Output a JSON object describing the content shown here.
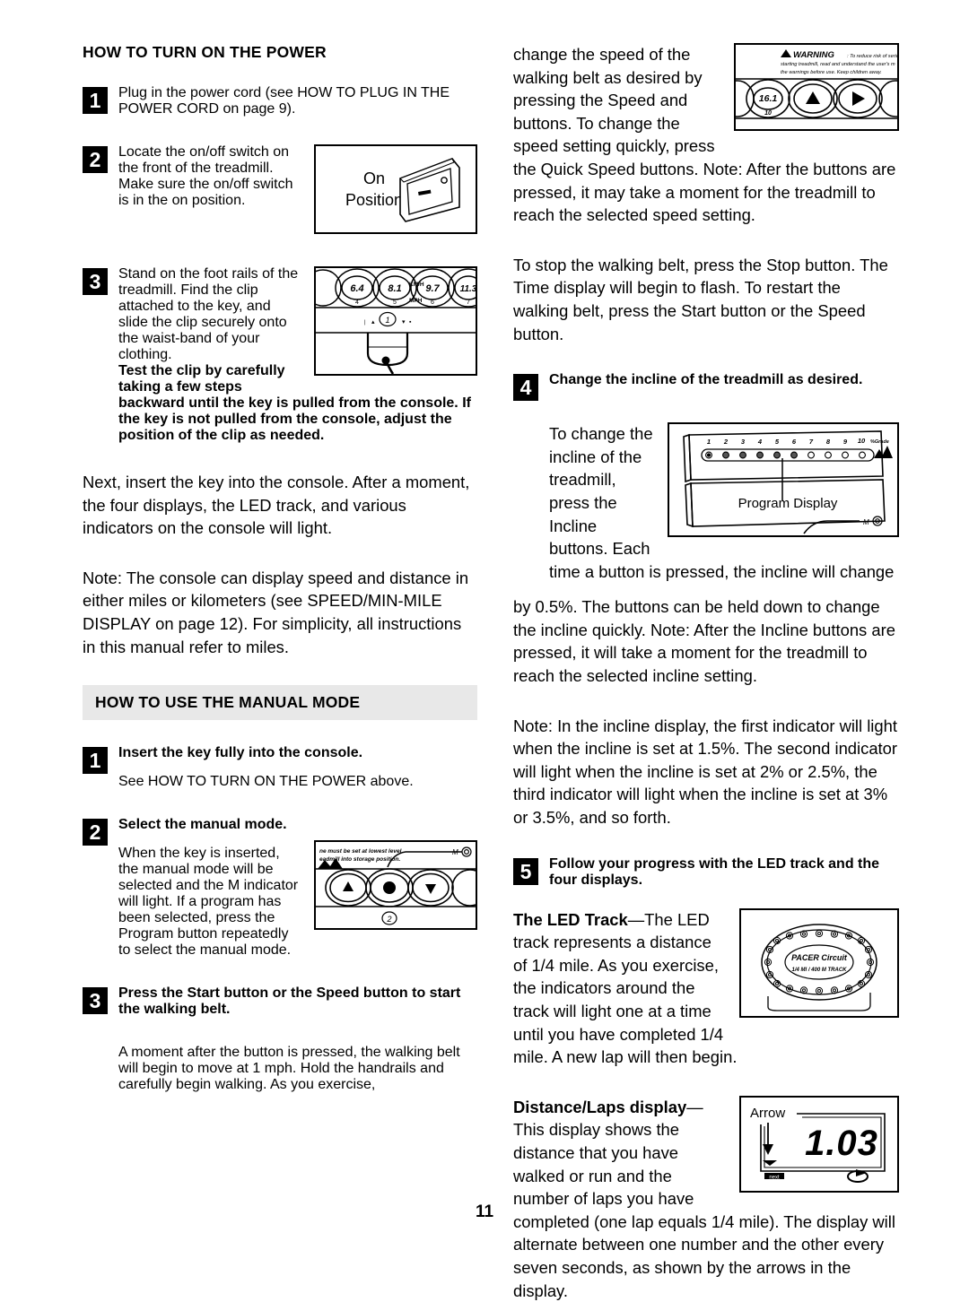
{
  "page": {
    "number": "11"
  },
  "left_column": {
    "section1": {
      "title": "HOW TO TURN ON THE POWER",
      "steps": [
        {
          "num": "1",
          "text": "Plug in the power cord (see HOW TO PLUG IN THE POWER CORD on page 9)."
        },
        {
          "num": "2",
          "text": "Locate the on/off switch on the front of the treadmill. Make sure the on/off switch is in the on position."
        },
        {
          "num": "3",
          "text": "Stand on the foot rails of the treadmill. Find the clip attached to the key, and slide the clip securely onto the waist-band of your clothing. ",
          "bold_text": "Test the clip by carefully taking a few steps backward until the key is pulled from the console. If the key is not pulled from the console, adjust the position of the clip as needed."
        }
      ],
      "paragraph_key": "Next, insert the key into the console. After a moment, the four displays, the LED track, and various indicators on the console will light.",
      "paragraph_note": "Note: The console can display speed and distance in either miles or kilometers (see SPEED/MIN-MILE DISPLAY on page 12). For simplicity, all instructions in this manual refer to miles."
    },
    "section2": {
      "title": "HOW TO USE THE MANUAL MODE",
      "steps": [
        {
          "num": "1",
          "heading": "Insert the key fully into the console.",
          "text": "See HOW TO TURN ON THE POWER above."
        },
        {
          "num": "2",
          "heading": "Select the manual mode.",
          "text": "When the key is inserted, the manual mode will be selected and the M indicator will light. If a program has been selected, press the Program button repeatedly to select the manual mode."
        },
        {
          "num": "3",
          "heading": "Press the Start button or the Speed     button to start the walking belt.",
          "text": "A moment after the button is pressed, the walking belt will begin to move at 1 mph. Hold the handrails and carefully begin walking. As you exercise,"
        }
      ]
    },
    "figures": {
      "switch": {
        "label_line1": "On",
        "label_line2": "Position"
      },
      "quick_speed": {
        "buttons": [
          {
            "kmh": "6.4",
            "mph": "4"
          },
          {
            "kmh": "8.1",
            "mph": "5"
          },
          {
            "kmh": "9.7",
            "mph": "6"
          },
          {
            "kmh": "11.3",
            "mph": "7"
          }
        ],
        "unit_top": "KM/H",
        "unit_bottom": "MPH",
        "callout": "1"
      },
      "console_manual": {
        "note_line1": "ne must be set at lowest level",
        "note_line2": "eadmill into storage position.",
        "m_indicator": "M",
        "callout": "2"
      }
    }
  },
  "right_column": {
    "paragraph_speed": "change the speed of the walking belt as desired by pressing the Speed     and     buttons. To change the speed setting quickly, press the Quick Speed buttons. Note: After the buttons are pressed, it may take a moment for the treadmill to reach the selected speed setting.",
    "paragraph_stop": "To stop the walking belt, press the Stop button. The Time display will begin to flash. To restart the walking belt, press the Start button or the Speed     button.",
    "steps": [
      {
        "num": "4",
        "heading": "Change the incline of the treadmill as desired.",
        "text_wrap": "To change the incline of the treadmill, press the Incline buttons. Each time a button is pressed, the incline will change",
        "text_rest": "by 0.5%. The buttons can be held down to change the incline quickly. Note: After the Incline buttons are pressed, it will take a moment for the treadmill to reach the selected incline setting.",
        "note": "Note: In the incline display, the first indicator will light when the incline is set at 1.5%. The second indicator will light when the incline is set at 2% or 2.5%, the third indicator will light when the incline is set at 3% or 3.5%, and so forth."
      },
      {
        "num": "5",
        "heading": "Follow your progress with the LED track and the four displays.",
        "led_track_bold": "The LED Track",
        "led_track_text": "—The LED track represents a distance of 1/4 mile. As you exercise, the indicators around the track will light one at a time until you have completed 1/4 mile. A new lap will then begin.",
        "distance_bold": "Distance/Laps display",
        "distance_text": "—This display shows the distance that you have walked or run and the number of laps you have completed (one lap equals 1/4 mile). The display will alternate between one number and the other every seven seconds, as shown by the arrows in the display."
      }
    ],
    "figures": {
      "warning_console": {
        "warning_word": "WARNING",
        "warning_line1": ": To reduce risk of serious injur",
        "warning_line2": "starting treadmill, read and understand the user's m",
        "warning_line3": "the warnings before use.   Keep children away.",
        "speed_value": "16.1",
        "speed_sub": "10"
      },
      "program_display": {
        "ticks": [
          "1",
          "2",
          "3",
          "4",
          "5",
          "6",
          "7",
          "8",
          "9",
          "10"
        ],
        "grade_label": "%Grade",
        "lit_count": 6,
        "total_indicators": 10,
        "caption": "Program Display",
        "m_indicator": "M"
      },
      "pacer_circuit": {
        "title": "PACER Circuit",
        "subtitle": "1/4 MI  /  400 M  TRACK",
        "indicator_count": 22
      },
      "distance_display": {
        "arrow_label": "Arrow",
        "value": "1.03",
        "unit_label": "next"
      }
    }
  },
  "colors": {
    "ink": "#000000",
    "band": "#e8e8e8",
    "paper": "#ffffff"
  }
}
